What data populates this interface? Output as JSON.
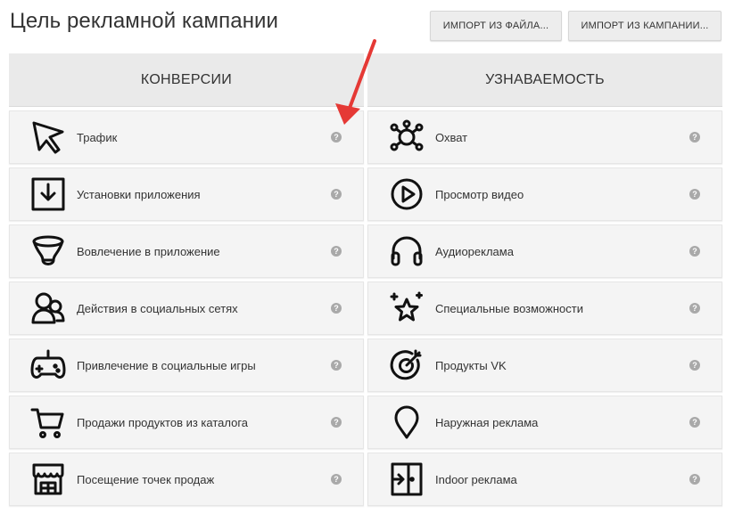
{
  "title": "Цель рекламной кампании",
  "buttons": {
    "import_file": "ИМПОРТ ИЗ ФАЙЛА...",
    "import_campaign": "ИМПОРТ ИЗ КАМПАНИИ..."
  },
  "columns": [
    {
      "header": "КОНВЕРСИИ",
      "items": [
        {
          "label": "Трафик",
          "icon": "cursor-icon"
        },
        {
          "label": "Установки приложения",
          "icon": "download-box-icon"
        },
        {
          "label": "Вовлечение в приложение",
          "icon": "funnel-icon"
        },
        {
          "label": "Действия в социальных сетях",
          "icon": "user-group-icon"
        },
        {
          "label": "Привлечение в социальные игры",
          "icon": "gamepad-icon"
        },
        {
          "label": "Продажи продуктов из каталога",
          "icon": "cart-icon"
        },
        {
          "label": "Посещение точек продаж",
          "icon": "store-icon"
        }
      ]
    },
    {
      "header": "УЗНАВАЕМОСТЬ",
      "items": [
        {
          "label": "Охват",
          "icon": "network-icon"
        },
        {
          "label": "Просмотр видео",
          "icon": "play-circle-icon"
        },
        {
          "label": "Аудиореклама",
          "icon": "headphones-icon"
        },
        {
          "label": "Специальные возможности",
          "icon": "star-sparkle-icon"
        },
        {
          "label": "Продукты VK",
          "icon": "target-icon"
        },
        {
          "label": "Наружная реклама",
          "icon": "map-pin-icon"
        },
        {
          "label": "Indoor реклама",
          "icon": "door-enter-icon"
        }
      ]
    }
  ],
  "help_glyph": "?",
  "colors": {
    "arrow": "#e53935",
    "help": "#a9a9a9",
    "tile": "#f4f4f4",
    "header": "#eaeaea"
  }
}
